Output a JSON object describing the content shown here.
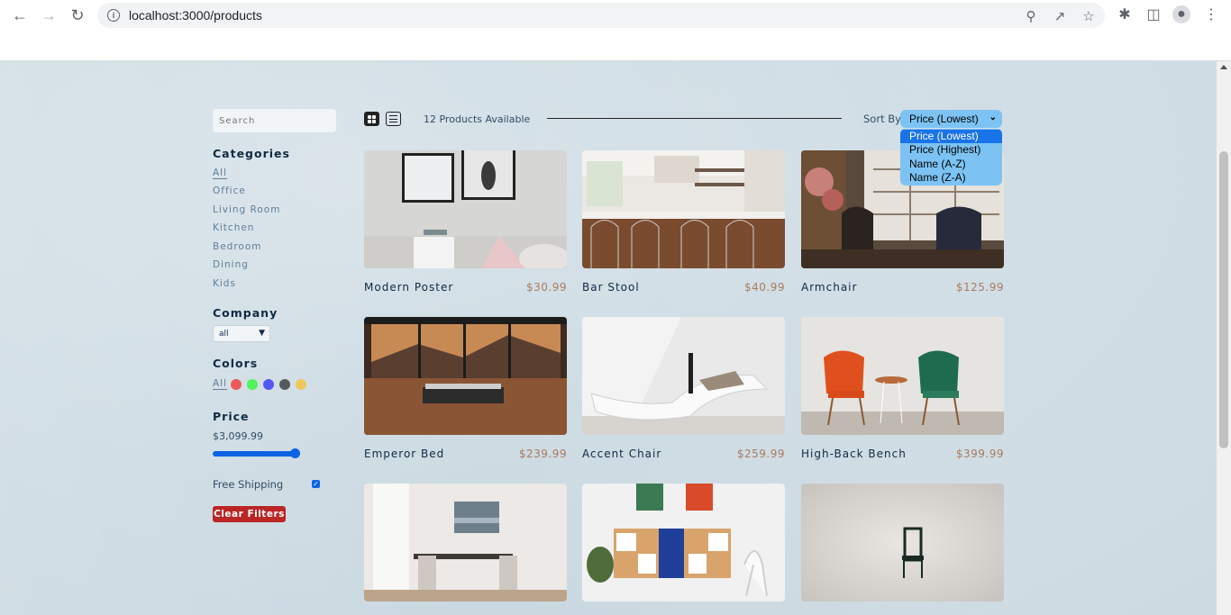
{
  "browser": {
    "url": "localhost:3000/products"
  },
  "filters": {
    "search_placeholder": "Search",
    "categories_title": "Categories",
    "categories": [
      "All",
      "Office",
      "Living Room",
      "Kitchen",
      "Bedroom",
      "Dining",
      "Kids"
    ],
    "company_title": "Company",
    "company_value": "all",
    "colors_title": "Colors",
    "colors_all": "All",
    "colors": [
      "#ff0000",
      "#00ff00",
      "#0000ff",
      "#000000",
      "#ffb900"
    ],
    "price_title": "Price",
    "price_value": "$3,099.99",
    "price_level_fraction": 1.0,
    "shipping_label": "Free Shipping",
    "shipping_checked": true,
    "clear_label": "Clear Filters"
  },
  "sort": {
    "count_text": "12 Products Available",
    "sort_label": "Sort By",
    "selected": "Price (Lowest)",
    "options": [
      "Price (Lowest)",
      "Price (Highest)",
      "Name (A-Z)",
      "Name (Z-A)"
    ]
  },
  "products": [
    {
      "name": "Modern Poster",
      "price": "$30.99"
    },
    {
      "name": "Bar Stool",
      "price": "$40.99"
    },
    {
      "name": "Armchair",
      "price": "$125.99"
    },
    {
      "name": "Emperor Bed",
      "price": "$239.99"
    },
    {
      "name": "Accent Chair",
      "price": "$259.99"
    },
    {
      "name": "High-Back Bench",
      "price": "$399.99"
    },
    {
      "name": "",
      "price": ""
    },
    {
      "name": "",
      "price": ""
    },
    {
      "name": "",
      "price": ""
    }
  ]
}
